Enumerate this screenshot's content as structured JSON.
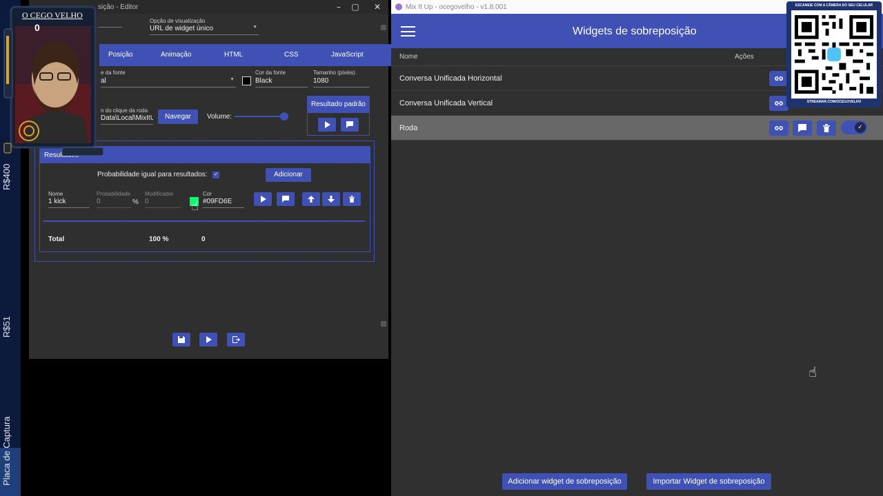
{
  "left_strip": {
    "labels": [
      "R$400",
      "R$51",
      "Placa de Captura"
    ]
  },
  "avatar": {
    "name": "O CEGO VELHO",
    "count": "0"
  },
  "editor": {
    "title": "sição - Editor",
    "view_option": {
      "label": "Opção de visualização",
      "value": "URL de widget único"
    },
    "tabs": [
      "Posição",
      "Animação",
      "HTML",
      "CSS",
      "JavaScript"
    ],
    "font_family": {
      "label": "e da fonte",
      "value": "al"
    },
    "font_color": {
      "label": "Cor da fonte",
      "value": "Black",
      "swatch": "#000000"
    },
    "font_size": {
      "label": "Tamanho (pixéis)",
      "value": "1080"
    },
    "sound": {
      "label": "n do clique da roda",
      "value": "Data\\Local\\MixItU"
    },
    "browse_label": "Navegar",
    "volume_label": "Volume:",
    "volume_level": 0.9,
    "default_result_label": "Resultado padrão",
    "results": {
      "header": "Resultados",
      "equal_prob_label": "Probabilidade igual para resultados:",
      "add_label": "Adicionar",
      "row": {
        "name_label": "Nome",
        "name_value": "1 kick",
        "prob_label": "Probabilidade",
        "prob_value": "0",
        "prob_unit": "%",
        "mod_label": "Modificador",
        "mod_value": "0",
        "color_label": "Cor",
        "color_value": "#09FD6E"
      },
      "total_label": "Total",
      "total_percent": "100 %",
      "total_mod": "0"
    }
  },
  "mixitup": {
    "window_title": "Mix It Up - ocegovelho - v1.8.001",
    "page_title": "Widgets de sobreposição",
    "columns": {
      "name": "Nome",
      "actions": "Ações"
    },
    "rows": [
      {
        "name": "Conversa Unificada Horizontal"
      },
      {
        "name": "Conversa Unificada Vertical"
      },
      {
        "name": "Roda"
      }
    ],
    "add_widget_label": "Adicionar widget de sobreposição",
    "import_widget_label": "Importar Widget de sobreposição"
  },
  "qr": {
    "top_text": "ESCANEIE COM A CÂMERA DO SEU CELULAR",
    "bottom_text": "STREAMAR.COM/OCEGOVELHO"
  },
  "colors": {
    "accent": "#3f51b5",
    "dark_bg": "#303030",
    "editor_bg": "#2f2f2f",
    "result_color": "#09FD6E"
  }
}
